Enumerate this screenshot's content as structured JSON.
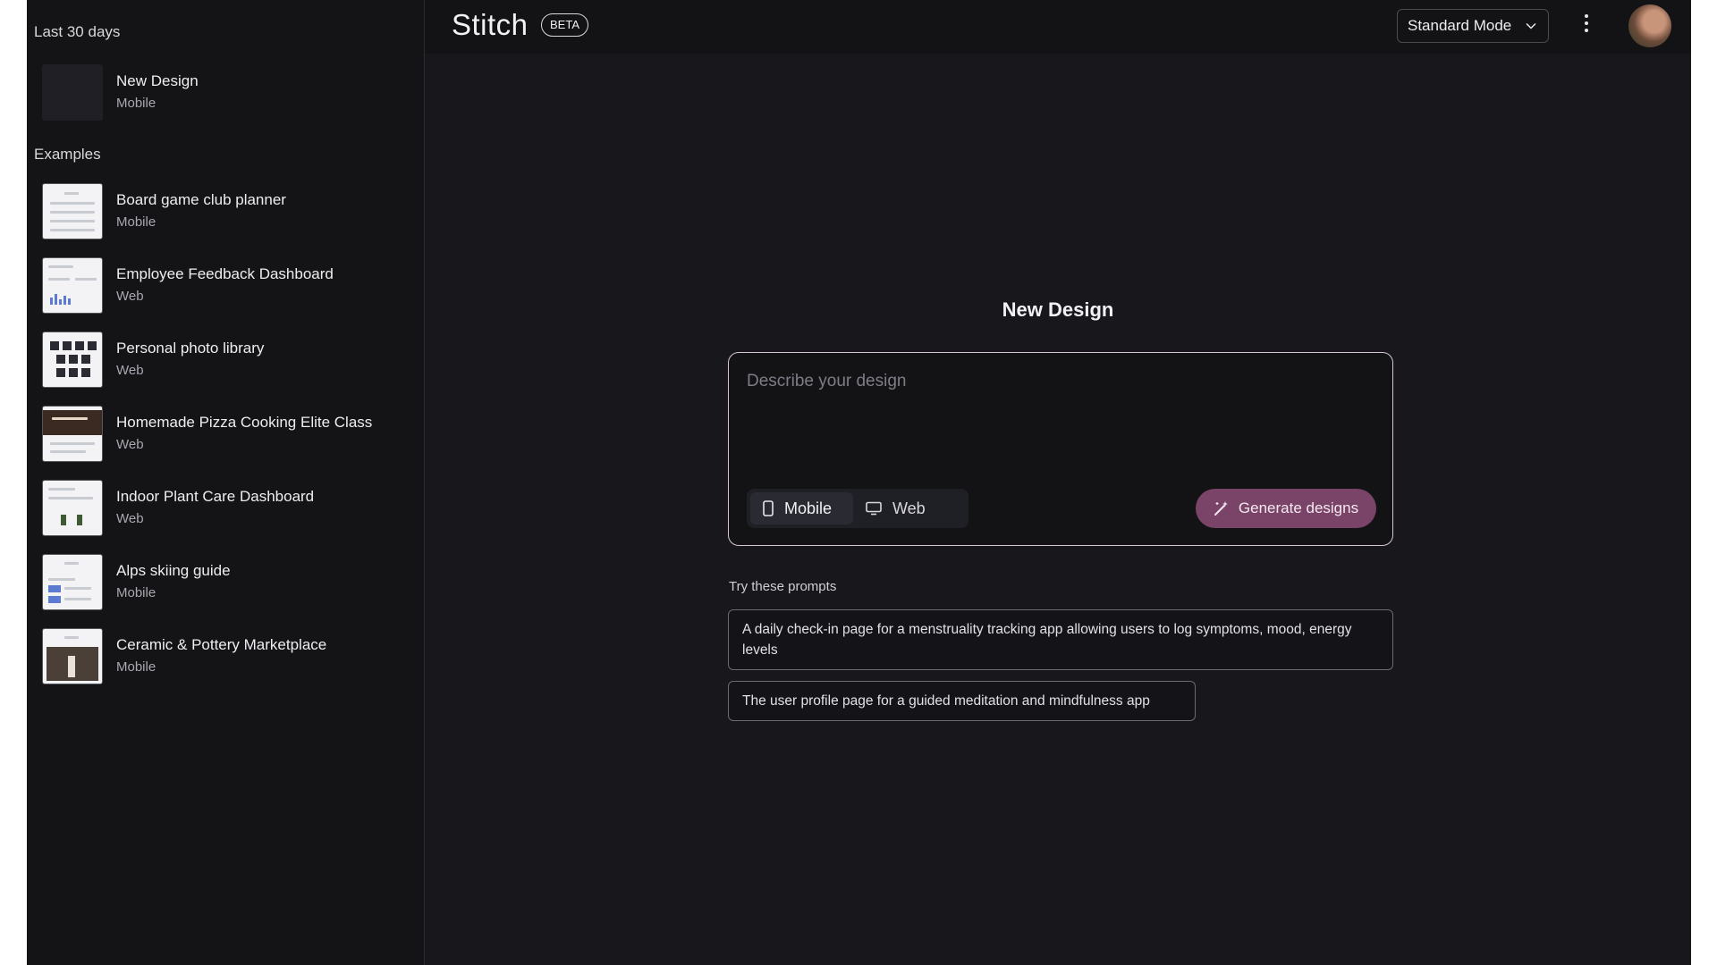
{
  "header": {
    "brand": "Stitch",
    "badge": "BETA",
    "mode_select": "Standard Mode"
  },
  "sidebar": {
    "recent_title": "Last 30 days",
    "recent": [
      {
        "title": "New Design",
        "type": "Mobile"
      }
    ],
    "examples_title": "Examples",
    "examples": [
      {
        "title": "Board game club planner",
        "type": "Mobile"
      },
      {
        "title": "Employee Feedback Dashboard",
        "type": "Web"
      },
      {
        "title": "Personal photo library",
        "type": "Web"
      },
      {
        "title": "Homemade Pizza Cooking Elite Class",
        "type": "Web"
      },
      {
        "title": "Indoor Plant Care Dashboard",
        "type": "Web"
      },
      {
        "title": "Alps skiing guide",
        "type": "Mobile"
      },
      {
        "title": "Ceramic & Pottery Marketplace",
        "type": "Mobile"
      }
    ]
  },
  "main": {
    "heading": "New Design",
    "input_placeholder": "Describe your design",
    "toggle": {
      "mobile": "Mobile",
      "web": "Web",
      "selected": "Mobile"
    },
    "generate_label": "Generate designs",
    "try_label": "Try these prompts",
    "prompts": [
      "A daily check-in page for a menstruality tracking app allowing users to log symptoms, mood, energy levels",
      "The user profile page for a guided meditation and mindfulness app"
    ]
  },
  "colors": {
    "background": "#17171c",
    "sidebar": "#141417",
    "accent_button": "#7a4469",
    "input_border": "#d8c6d6"
  },
  "icons": [
    "chevron-down-icon",
    "more-vert-icon",
    "avatar",
    "phone-icon",
    "monitor-icon",
    "magic-wand-icon"
  ]
}
